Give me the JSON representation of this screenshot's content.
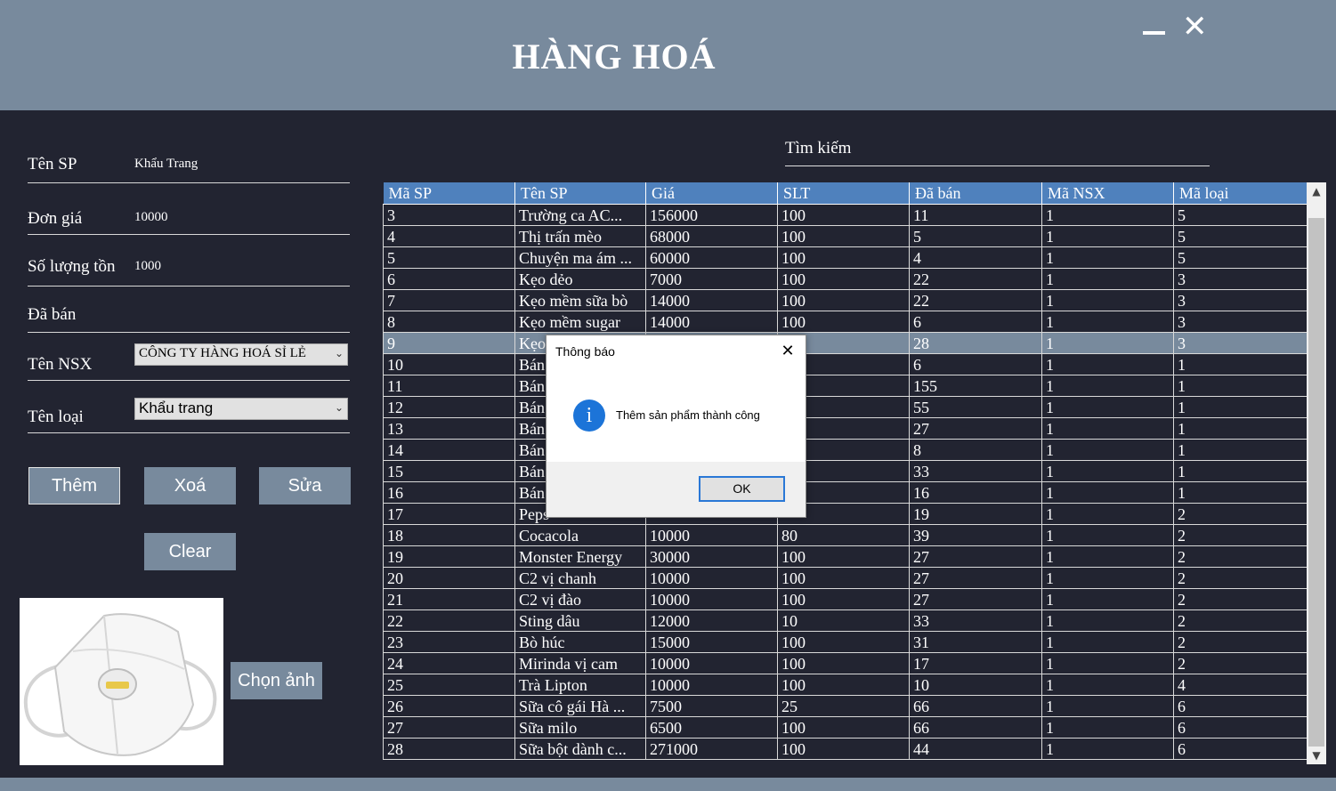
{
  "window": {
    "title": "HÀNG HOÁ"
  },
  "form": {
    "ten_sp": {
      "label": "Tên SP",
      "value": "Khẩu Trang"
    },
    "don_gia": {
      "label": "Đơn giá",
      "value": "10000"
    },
    "so_luong_ton": {
      "label": "Số lượng tồn",
      "value": "1000"
    },
    "da_ban": {
      "label": "Đã bán",
      "value": ""
    },
    "ten_nsx": {
      "label": "Tên NSX",
      "value": "CÔNG TY HÀNG HOÁ SỈ LẺ"
    },
    "ten_loai": {
      "label": "Tên loại",
      "value": "Khẩu trang"
    }
  },
  "buttons": {
    "them": "Thêm",
    "xoa": "Xoá",
    "sua": "Sửa",
    "clear": "Clear",
    "chon_anh": "Chọn ảnh"
  },
  "search": {
    "label": "Tìm kiếm",
    "value": ""
  },
  "table": {
    "columns": [
      "Mã SP",
      "Tên SP",
      "Giá",
      "SLT",
      "Đã bán",
      "Mã NSX",
      "Mã loại"
    ],
    "selected_row": 6,
    "rows": [
      [
        "3",
        "Trường ca AC...",
        "156000",
        "100",
        "11",
        "1",
        "5"
      ],
      [
        "4",
        "Thị trấn mèo",
        "68000",
        "100",
        "5",
        "1",
        "5"
      ],
      [
        "5",
        "Chuyện ma ám ...",
        "60000",
        "100",
        "4",
        "1",
        "5"
      ],
      [
        "6",
        "Kẹo dẻo",
        "7000",
        "100",
        "22",
        "1",
        "3"
      ],
      [
        "7",
        "Kẹo mềm sữa bò",
        "14000",
        "100",
        "22",
        "1",
        "3"
      ],
      [
        "8",
        "Kẹo mềm sugar",
        "14000",
        "100",
        "6",
        "1",
        "3"
      ],
      [
        "9",
        "Kẹo",
        "",
        "",
        "28",
        "1",
        "3"
      ],
      [
        "10",
        "Bán",
        "",
        "",
        "6",
        "1",
        "1"
      ],
      [
        "11",
        "Bán",
        "",
        "",
        "155",
        "1",
        "1"
      ],
      [
        "12",
        "Bán",
        "",
        "",
        "55",
        "1",
        "1"
      ],
      [
        "13",
        "Bán",
        "",
        "",
        "27",
        "1",
        "1"
      ],
      [
        "14",
        "Bán",
        "",
        "",
        "8",
        "1",
        "1"
      ],
      [
        "15",
        "Bán",
        "",
        "",
        "33",
        "1",
        "1"
      ],
      [
        "16",
        "Bán",
        "",
        "",
        "16",
        "1",
        "1"
      ],
      [
        "17",
        "Peps",
        "",
        "",
        "19",
        "1",
        "2"
      ],
      [
        "18",
        "Cocacola",
        "10000",
        "80",
        "39",
        "1",
        "2"
      ],
      [
        "19",
        "Monster Energy",
        "30000",
        "100",
        "27",
        "1",
        "2"
      ],
      [
        "20",
        "C2 vị chanh",
        "10000",
        "100",
        "27",
        "1",
        "2"
      ],
      [
        "21",
        "C2 vị đào",
        "10000",
        "100",
        "27",
        "1",
        "2"
      ],
      [
        "22",
        "Sting dâu",
        "12000",
        "10",
        "33",
        "1",
        "2"
      ],
      [
        "23",
        "Bò húc",
        "15000",
        "100",
        "31",
        "1",
        "2"
      ],
      [
        "24",
        "Mirinda vị cam",
        "10000",
        "100",
        "17",
        "1",
        "2"
      ],
      [
        "25",
        "Trà Lipton",
        "10000",
        "100",
        "10",
        "1",
        "4"
      ],
      [
        "26",
        "Sữa cô gái Hà ...",
        "7500",
        "25",
        "66",
        "1",
        "6"
      ],
      [
        "27",
        "Sữa milo",
        "6500",
        "100",
        "66",
        "1",
        "6"
      ],
      [
        "28",
        "Sữa bột dành c...",
        "271000",
        "100",
        "44",
        "1",
        "6"
      ]
    ]
  },
  "dialog": {
    "title": "Thông báo",
    "message": "Thêm sản phẩm thành công",
    "ok": "OK",
    "icon": "info-icon"
  },
  "icons": {
    "minimize": "minimize-icon",
    "close": "close-icon",
    "info": "i"
  },
  "colors": {
    "header": "#788a9d",
    "background": "#222431",
    "table_header": "#4f81bd",
    "selected_row": "#788a9d"
  }
}
